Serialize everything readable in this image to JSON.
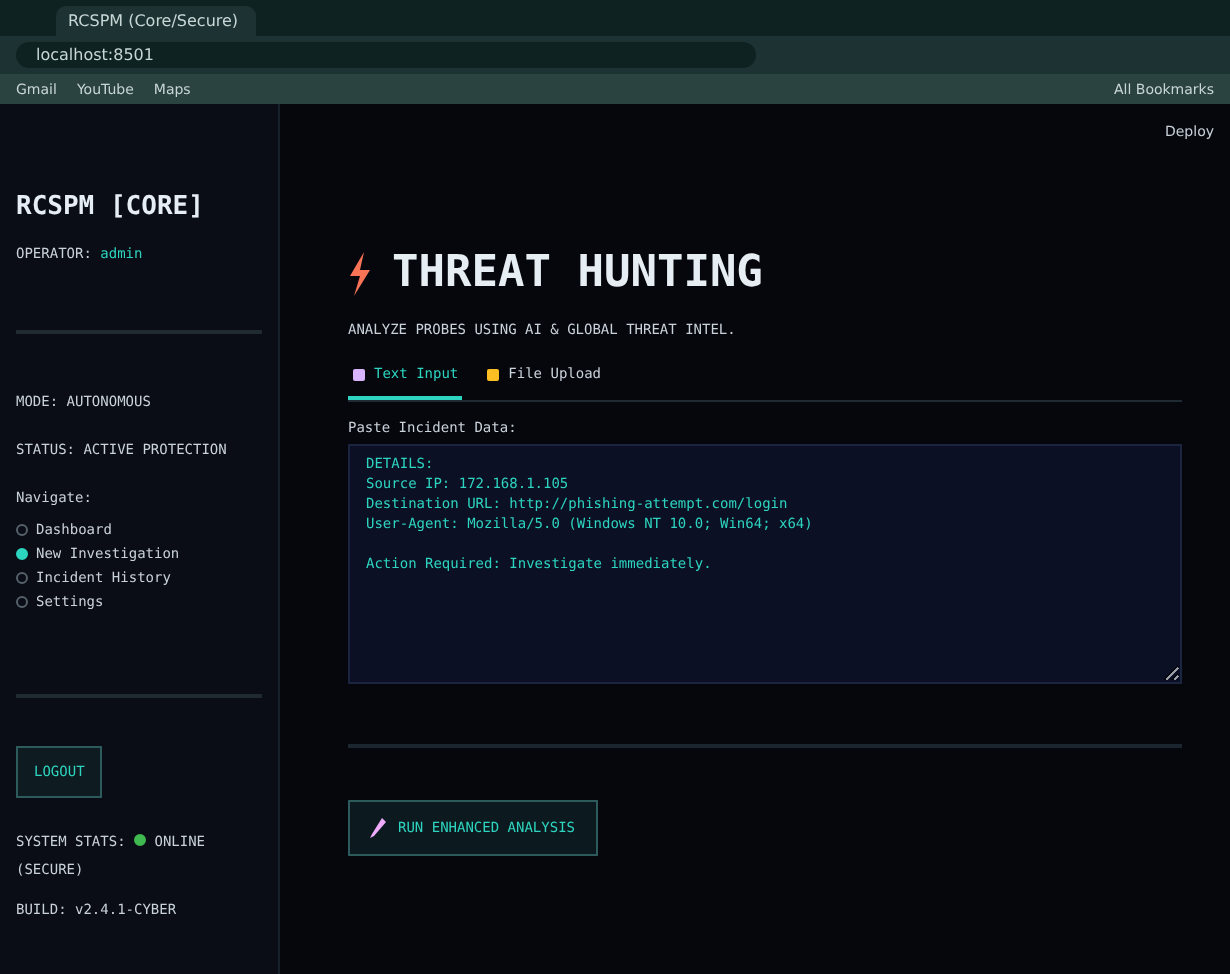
{
  "browser": {
    "tab_title": "RCSPM (Core/Secure)",
    "url": "localhost:8501",
    "bookmarks": [
      "Gmail",
      "YouTube",
      "Maps"
    ],
    "all_bookmarks": "All Bookmarks"
  },
  "sidebar": {
    "title": "RCSPM [CORE]",
    "operator_label": "OPERATOR:",
    "operator": "admin",
    "mode": "MODE: AUTONOMOUS",
    "status": "STATUS: ACTIVE PROTECTION",
    "nav_label": "Navigate:",
    "nav": [
      {
        "label": "Dashboard",
        "selected": false
      },
      {
        "label": "New Investigation",
        "selected": true
      },
      {
        "label": "Incident History",
        "selected": false
      },
      {
        "label": "Settings",
        "selected": false
      }
    ],
    "logout": "LOGOUT",
    "system_status": "SYSTEM STATS:",
    "online": "ONLINE",
    "secure": "(SECURE)",
    "build": "BUILD: v2.4.1-CYBER"
  },
  "header": {
    "deploy": "Deploy"
  },
  "main": {
    "title": "THREAT HUNTING",
    "subtitle": "ANALYZE PROBES USING AI & GLOBAL THREAT INTEL.",
    "tabs": [
      {
        "label": "Text Input",
        "selected": true
      },
      {
        "label": "File Upload",
        "selected": false
      }
    ],
    "field_label": "Paste Incident Data:",
    "field_value": "DETAILS:\nSource IP: 172.168.1.105\nDestination URL: http://phishing-attempt.com/login\nUser-Agent: Mozilla/5.0 (Windows NT 10.0; Win64; x64)\n\nAction Required: Investigate immediately.",
    "run_button": "RUN ENHANCED ANALYSIS"
  }
}
